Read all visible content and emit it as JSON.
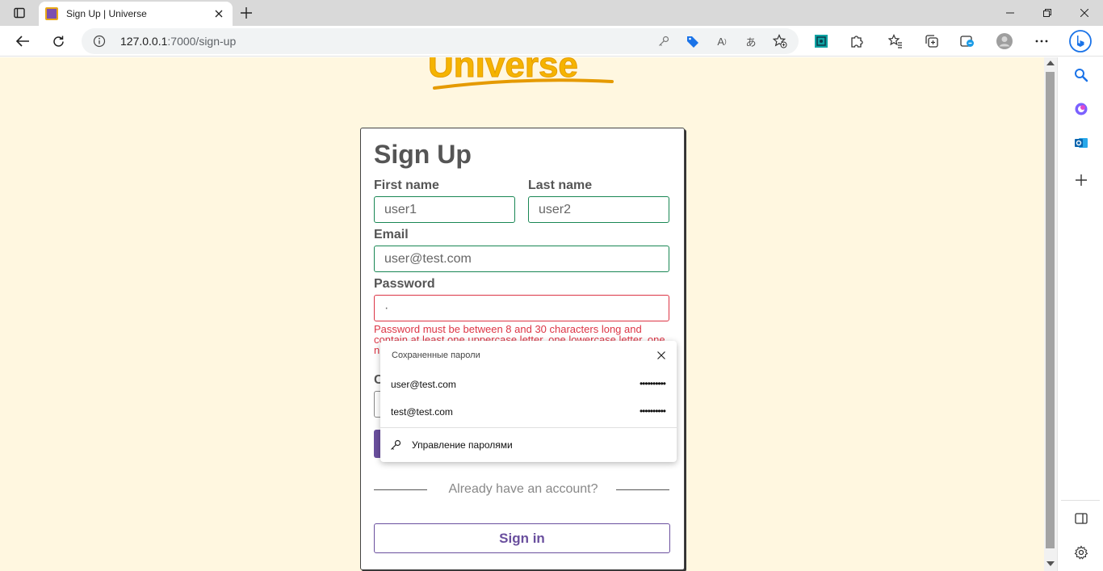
{
  "browser": {
    "tab_title": "Sign Up | Universe",
    "url_host": "127.0.0.1",
    "url_path": ":7000/sign-up"
  },
  "page": {
    "logo_text": "Universe",
    "heading": "Sign Up",
    "first_name_label": "First name",
    "first_name_value": "user1",
    "last_name_label": "Last name",
    "last_name_value": "user2",
    "email_label": "Email",
    "email_value": "user@test.com",
    "password_label": "Password",
    "password_value": "·",
    "password_error": "Password must be between 8 and 30 characters long and contain at least one uppercase letter, one lowercase letter, one number and one special character",
    "confirm_label_partial": "C",
    "divider_text": "Already have an account?",
    "signin_label": "Sign in"
  },
  "password_popup": {
    "title": "Сохраненные пароли",
    "entries": [
      {
        "username": "user@test.com",
        "password_mask": "••••••••••"
      },
      {
        "username": "test@test.com",
        "password_mask": "••••••••••"
      }
    ],
    "manage_label": "Управление паролями"
  },
  "colors": {
    "page_bg": "#fff7e0",
    "valid_border": "#198754",
    "invalid_border": "#dc3545",
    "brand_purple": "#6a4f9e",
    "logo_yellow": "#f5b400"
  }
}
